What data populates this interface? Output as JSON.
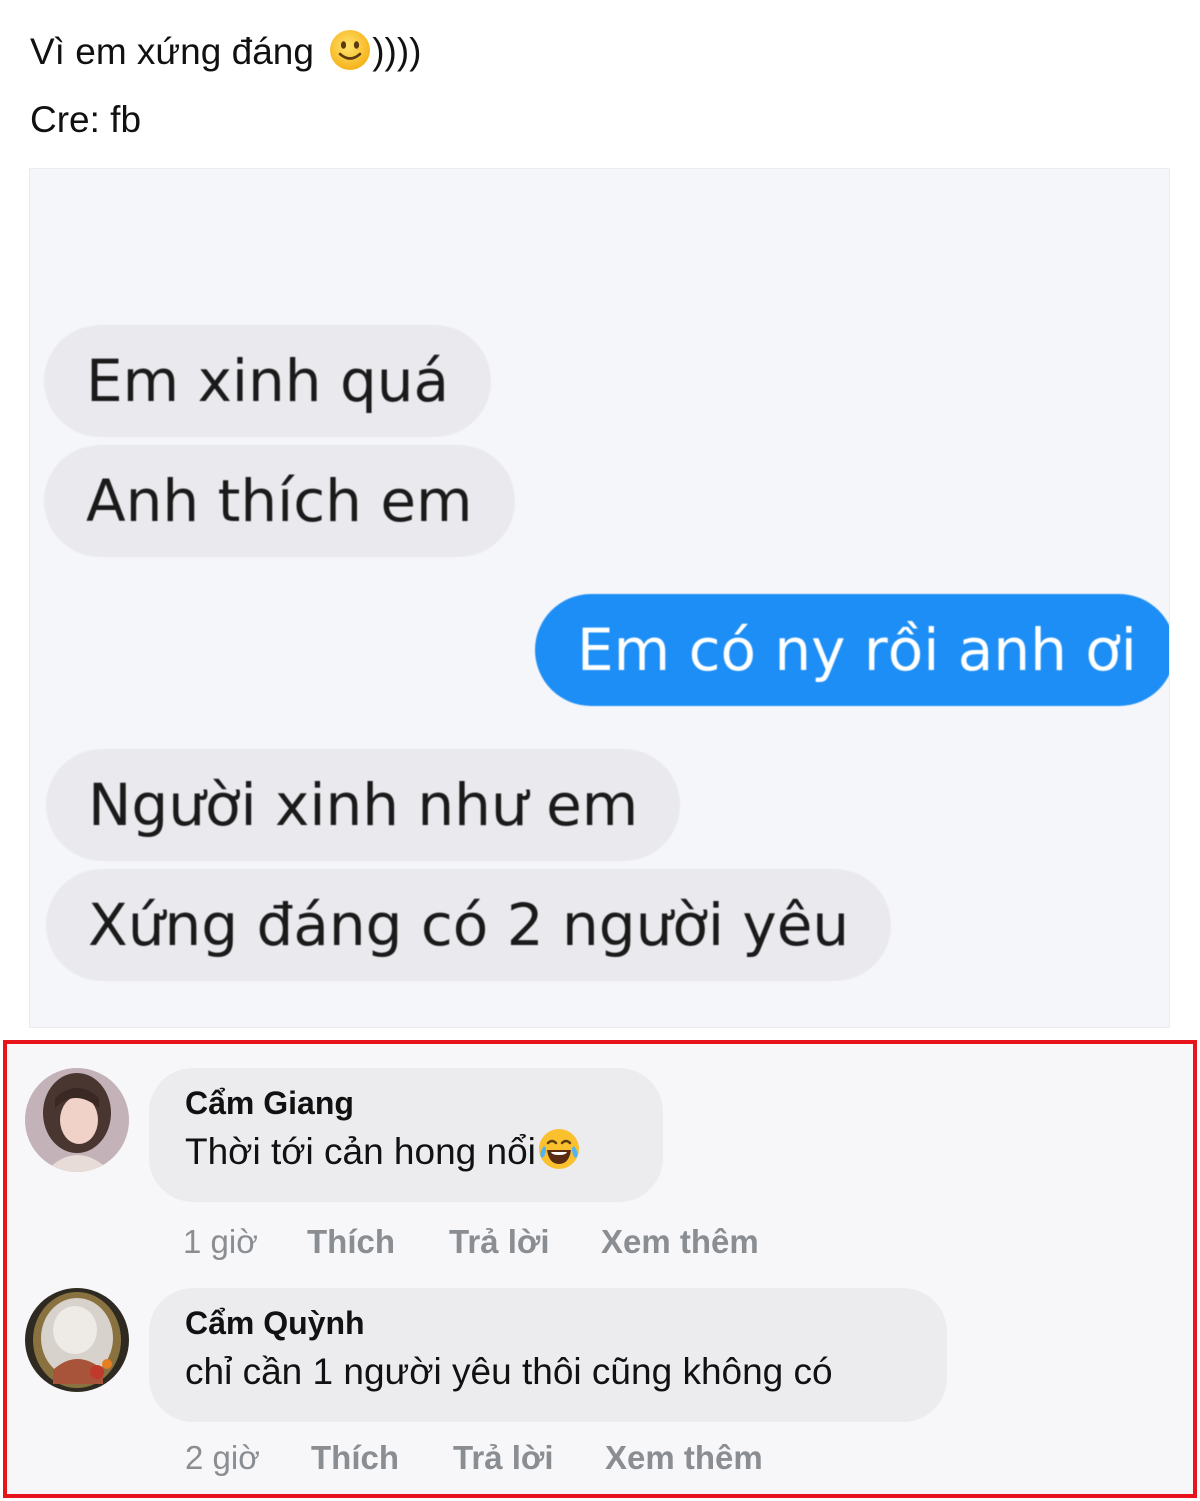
{
  "post": {
    "caption": "Vì em xứng đáng ",
    "caption_suffix": "))))",
    "caption_emoji": "slightly-smiling-face-icon",
    "credit": "Cre: fb"
  },
  "chat": {
    "messages": [
      {
        "side": "incoming",
        "text": "Em xinh quá"
      },
      {
        "side": "incoming",
        "text": "Anh thích em"
      },
      {
        "side": "outgoing",
        "text": "Em có ny rồi anh ơi"
      },
      {
        "side": "incoming",
        "text": "Người xinh như em"
      },
      {
        "side": "incoming",
        "text": "Xứng đáng có 2 người yêu"
      }
    ],
    "colors": {
      "incoming_bubble": "#e9e9ee",
      "outgoing_bubble": "#1d8ef5",
      "background": "#f5f6fa"
    }
  },
  "comments": {
    "highlight_color": "#e8141c",
    "items": [
      {
        "author": "Cẩm Giang",
        "text": "Thời tới cản hong nổi",
        "emoji": "laughing-tears-icon",
        "time": "1 giờ",
        "like": "Thích",
        "reply": "Trả lời",
        "more": "Xem thêm"
      },
      {
        "author": "Cẩm Quỳnh",
        "text": "chỉ cần 1 người yêu thôi cũng không có",
        "time": "2 giờ",
        "like": "Thích",
        "reply": "Trả lời",
        "more": "Xem thêm"
      }
    ]
  }
}
